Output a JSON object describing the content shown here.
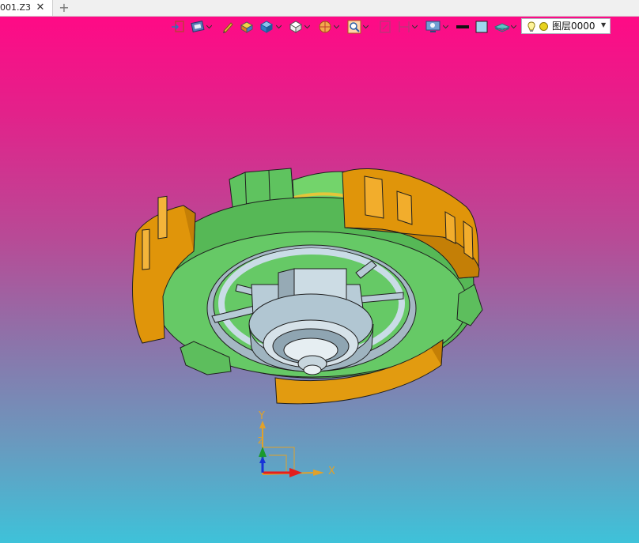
{
  "tabs": [
    {
      "label": "001.Z3",
      "close": "✕"
    }
  ],
  "add_tab": "+",
  "toolbar": {
    "buttons": [
      {
        "name": "exit-sketch-icon",
        "dropdown": false
      },
      {
        "name": "display-mode-icon",
        "dropdown": true
      },
      {
        "name": "pencil-icon",
        "dropdown": false
      },
      {
        "name": "shaded-box-icon",
        "dropdown": false
      },
      {
        "name": "box-view-icon",
        "dropdown": true
      },
      {
        "name": "view-cube-icon",
        "dropdown": true
      },
      {
        "name": "render-sphere-icon",
        "dropdown": true
      },
      {
        "name": "zoom-fit-icon",
        "dropdown": true
      },
      {
        "name": "pick-filter-icon",
        "dropdown": false
      },
      {
        "name": "section-view-icon",
        "dropdown": true
      },
      {
        "name": "display-settings-icon",
        "dropdown": true
      },
      {
        "name": "line-color-icon",
        "dropdown": false
      },
      {
        "name": "face-color-icon",
        "dropdown": false
      },
      {
        "name": "layer-stack-icon",
        "dropdown": true
      }
    ]
  },
  "layer": {
    "value": "图层0000"
  },
  "axes": {
    "x": "X",
    "y": "Y",
    "z": "Z"
  },
  "colors": {
    "face_green": "#63c763",
    "face_orange": "#e49a0a",
    "metal": "#b9cdd9",
    "background_top": "#ff0a86",
    "background_bottom": "#3ec2d9"
  }
}
